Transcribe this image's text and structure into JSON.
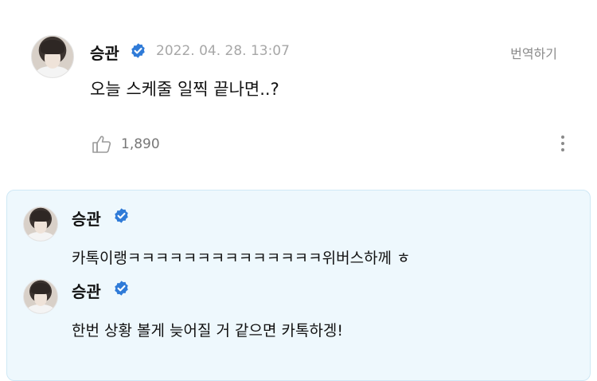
{
  "post": {
    "author": "승관",
    "timestamp": "2022. 04. 28. 13:07",
    "translate_label": "번역하기",
    "text": "오늘 스케줄 일찍 끝나면..?",
    "like_count": "1,890"
  },
  "replies": [
    {
      "author": "승관",
      "text": "카톡이랭ㅋㅋㅋㅋㅋㅋㅋㅋㅋㅋㅋㅋㅋㅋ위버스하께 ㅎ"
    },
    {
      "author": "승관",
      "text": "한번 상황 볼게 늦어질 거 같으면 카톡하겡!"
    }
  ],
  "colors": {
    "verified": "#2f7bd8",
    "reply_background": "#eef8fd",
    "reply_border": "#cfe8f5",
    "muted_text": "#a7a7a7"
  },
  "icons": {
    "verified": "verified-badge-icon",
    "like": "thumbs-up-icon",
    "more": "more-vertical-icon"
  }
}
